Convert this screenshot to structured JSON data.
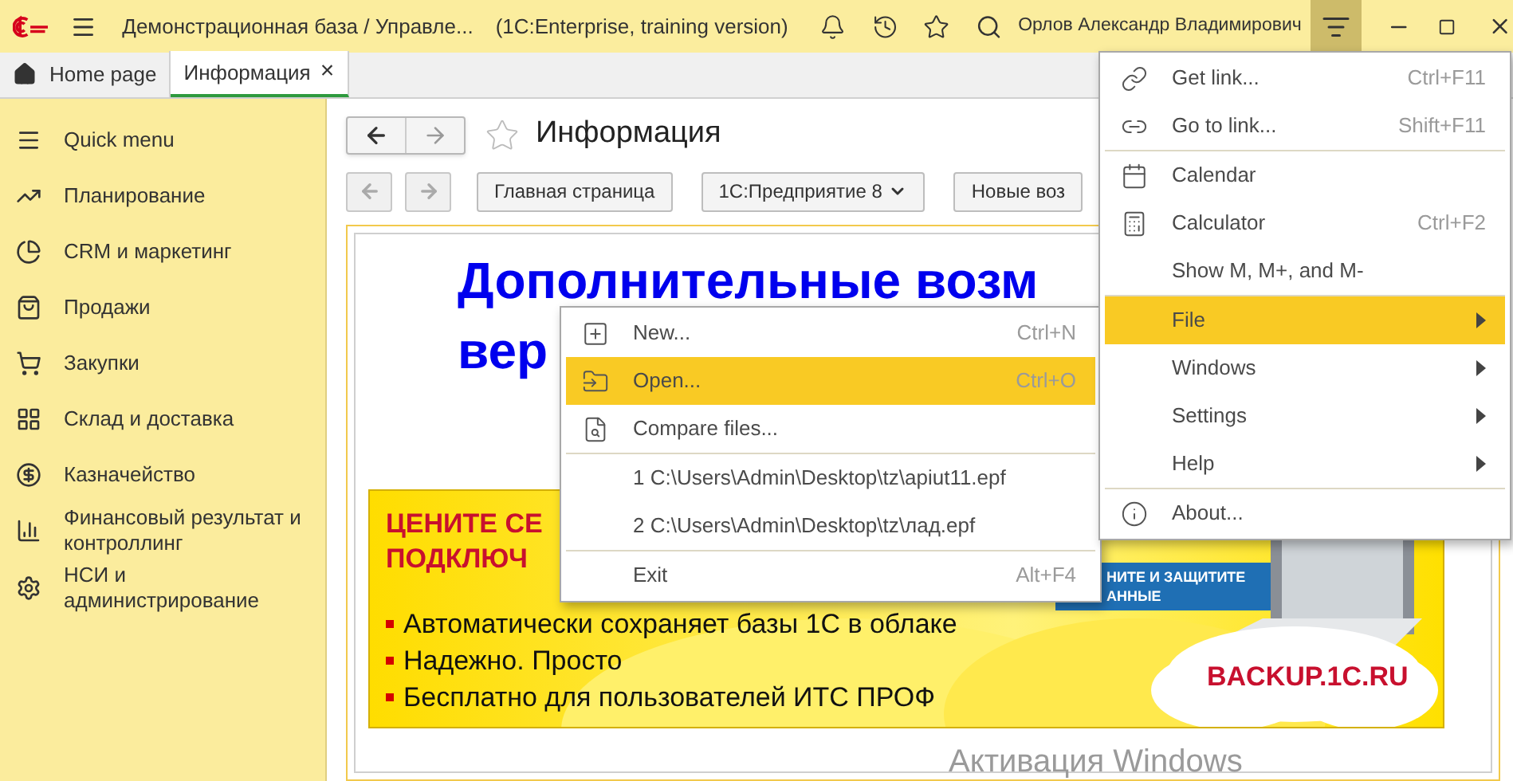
{
  "title_bar": {
    "app_title": "Демонстрационная база / Управле...",
    "edition": "(1С:Enterprise, training version)",
    "user": "Орлов Александр Владимирович",
    "menu_open": true
  },
  "tabs": [
    {
      "label": "Home page",
      "selected": false,
      "closable": false
    },
    {
      "label": "Информация",
      "selected": true,
      "closable": true,
      "close": "×"
    }
  ],
  "sidebar": {
    "items": [
      {
        "label": "Quick menu"
      },
      {
        "label": "Планирование"
      },
      {
        "label": "CRM и маркетинг"
      },
      {
        "label": "Продажи"
      },
      {
        "label": "Закупки"
      },
      {
        "label": "Склад и доставка"
      },
      {
        "label": "Казначейство"
      },
      {
        "label": "Финансовый результат и контроллинг"
      },
      {
        "label": "НСИ и администрирование"
      }
    ]
  },
  "page": {
    "title": "Информация",
    "favorite": false,
    "links": [
      {
        "label": "Главная страница",
        "dropdown": false
      },
      {
        "label": "1С:Предприятие 8",
        "dropdown": true
      },
      {
        "label": "Новые воз",
        "dropdown": false
      }
    ],
    "heading": [
      "Дополнительные возм",
      "вер"
    ],
    "banner": {
      "headline": [
        "ЦЕНИТЕ СЕ",
        "ПОДКЛЮЧ"
      ],
      "bullets": [
        "Автоматически сохраняет базы 1С в облаке",
        "Надежно. Просто",
        "Бесплатно для пользователей ИТС ПРОФ"
      ],
      "arrow_text": [
        "НИТЕ И ЗАЩИТИТЕ",
        "АННЫЕ"
      ],
      "site": "BACKUP.1C.RU"
    }
  },
  "main_menu": {
    "groups": [
      [
        {
          "label": "Get link...",
          "shortcut": "Ctrl+F11",
          "selected": false,
          "submenu": false
        },
        {
          "label": "Go to link...",
          "shortcut": "Shift+F11",
          "selected": false,
          "submenu": false
        }
      ],
      [
        {
          "label": "Calendar",
          "selected": false,
          "submenu": false
        },
        {
          "label": "Calculator",
          "shortcut": "Ctrl+F2",
          "selected": false,
          "submenu": false
        },
        {
          "label": "Show M, M+, and M-",
          "selected": false,
          "submenu": false
        }
      ],
      [
        {
          "label": "File",
          "selected": true,
          "submenu": true
        },
        {
          "label": "Windows",
          "selected": false,
          "submenu": true
        },
        {
          "label": "Settings",
          "selected": false,
          "submenu": true
        },
        {
          "label": "Help",
          "selected": false,
          "submenu": true
        }
      ],
      [
        {
          "label": "About...",
          "selected": false,
          "submenu": false
        }
      ]
    ]
  },
  "file_menu": {
    "groups": [
      [
        {
          "label": "New...",
          "shortcut": "Ctrl+N",
          "selected": false
        },
        {
          "label": "Open...",
          "shortcut": "Ctrl+O",
          "selected": true
        },
        {
          "label": "Compare files...",
          "selected": false
        }
      ],
      [
        {
          "label": "1 C:\\Users\\Admin\\Desktop\\tz\\apiut11.epf",
          "selected": false
        },
        {
          "label": "2 C:\\Users\\Admin\\Desktop\\tz\\лад.epf",
          "selected": false
        }
      ],
      [
        {
          "label": "Exit",
          "shortcut": "Alt+F4",
          "selected": false
        }
      ]
    ]
  },
  "os_notice": "Активация Windows"
}
